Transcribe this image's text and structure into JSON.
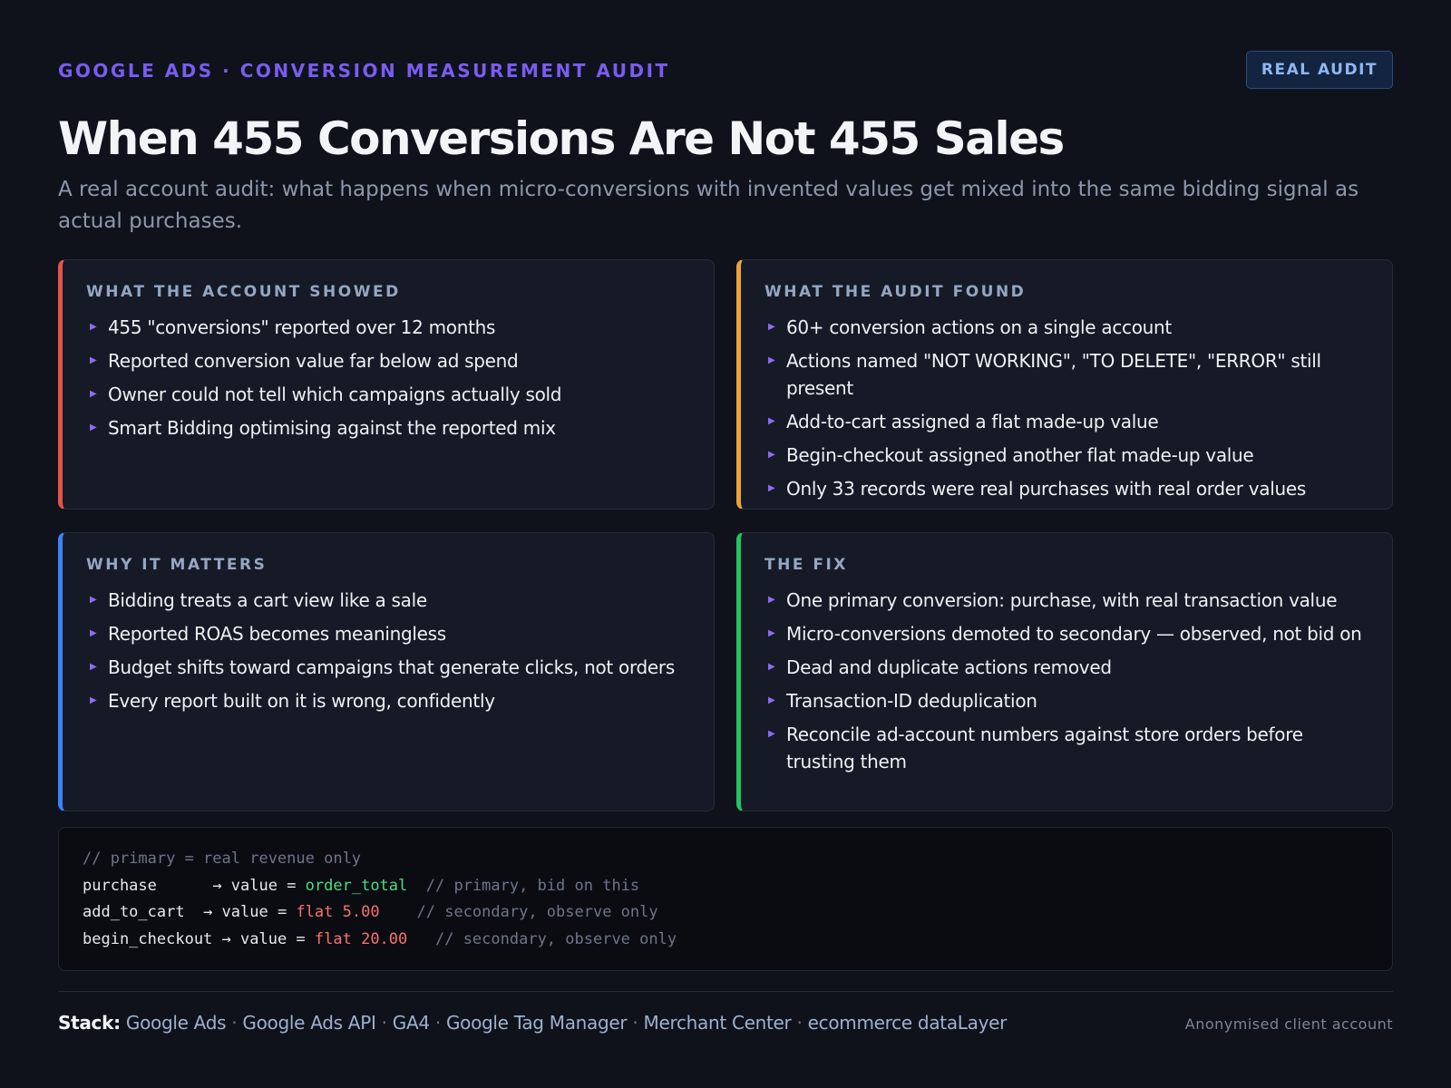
{
  "header": {
    "eyebrow": "GOOGLE ADS · CONVERSION MEASUREMENT AUDIT",
    "badge": "REAL AUDIT",
    "title": "When 455 Conversions Are Not 455 Sales",
    "subtitle": "A real account audit: what happens when micro-conversions with invented values get mixed into the same bidding signal as actual purchases."
  },
  "cards": [
    {
      "title": "WHAT THE ACCOUNT SHOWED",
      "accent": "#e5534b",
      "items": [
        "455 \"conversions\" reported over 12 months",
        "Reported conversion value far below ad spend",
        "Owner could not tell which campaigns actually sold",
        "Smart Bidding optimising against the reported mix"
      ]
    },
    {
      "title": "WHAT THE AUDIT FOUND",
      "accent": "#e8a33a",
      "items": [
        "60+ conversion actions on a single account",
        "Actions named \"NOT WORKING\", \"TO DELETE\", \"ERROR\" still present",
        "Add-to-cart assigned a flat made-up value",
        "Begin-checkout assigned another flat made-up value",
        "Only 33 records were real purchases with real order values"
      ]
    },
    {
      "title": "WHY IT MATTERS",
      "accent": "#3b82f6",
      "items": [
        "Bidding treats a cart view like a sale",
        "Reported ROAS becomes meaningless",
        "Budget shifts toward campaigns that generate clicks, not orders",
        "Every report built on it is wrong, confidently"
      ]
    },
    {
      "title": "THE FIX",
      "accent": "#22c55e",
      "items": [
        "One primary conversion: purchase, with real transaction value",
        "Micro-conversions demoted to secondary — observed, not bid on",
        "Dead and duplicate actions removed",
        "Transaction-ID deduplication",
        "Reconcile ad-account numbers against store orders before trusting them"
      ]
    }
  ],
  "code": {
    "comment": "// primary = real revenue only",
    "lines": [
      {
        "name": "purchase",
        "pad": "      ",
        "arrow": "→ value = ",
        "value": "order_total",
        "value_color": "green",
        "gap": "  ",
        "comment": "// primary, bid on this"
      },
      {
        "name": "add_to_cart",
        "pad": "  ",
        "arrow": "→ value = ",
        "value": "flat 5.00",
        "value_color": "red",
        "gap": "    ",
        "comment": "// secondary, observe only"
      },
      {
        "name": "begin_checkout",
        "pad": " ",
        "arrow": "→ value = ",
        "value": "flat 20.00",
        "value_color": "red",
        "gap": "   ",
        "comment": "// secondary, observe only"
      }
    ]
  },
  "footer": {
    "stack_label": "Stack:",
    "stack_items": [
      "Google Ads",
      "Google Ads API",
      "GA4",
      "Google Tag Manager",
      "Merchant Center",
      "ecommerce dataLayer"
    ],
    "separator": " · ",
    "note": "Anonymised client account"
  }
}
